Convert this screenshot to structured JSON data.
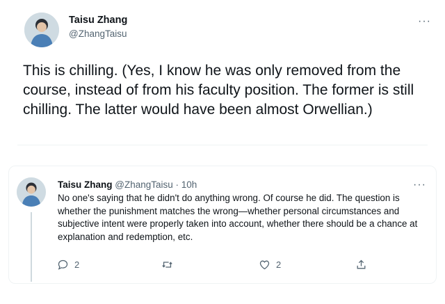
{
  "main_tweet": {
    "author_name": "Taisu Zhang",
    "handle": "@ZhangTaisu",
    "avatar_icon": "profile-photo",
    "text": "This is chilling.  (Yes, I know he was only removed from the course, instead of from his faculty position.  The former is still chilling.  The latter would have been almost Orwellian.)",
    "more_icon": "···"
  },
  "reply_tweet": {
    "author_name": "Taisu Zhang",
    "meta": "@ZhangTaisu · 10h",
    "avatar_icon": "profile-photo",
    "text": "No one's saying that he didn't do anything wrong. Of course he did. The question is whether the punishment matches the wrong—whether personal circumstances and subjective intent were properly taken into account, whether there should be a chance at explanation and redemption, etc.",
    "more_icon": "···",
    "actions": {
      "reply_count": "2",
      "retweet_count": "",
      "like_count": "2",
      "share_count": ""
    }
  },
  "colors": {
    "text": "#0f1419",
    "secondary": "#536471",
    "divider": "#eff3f4"
  }
}
